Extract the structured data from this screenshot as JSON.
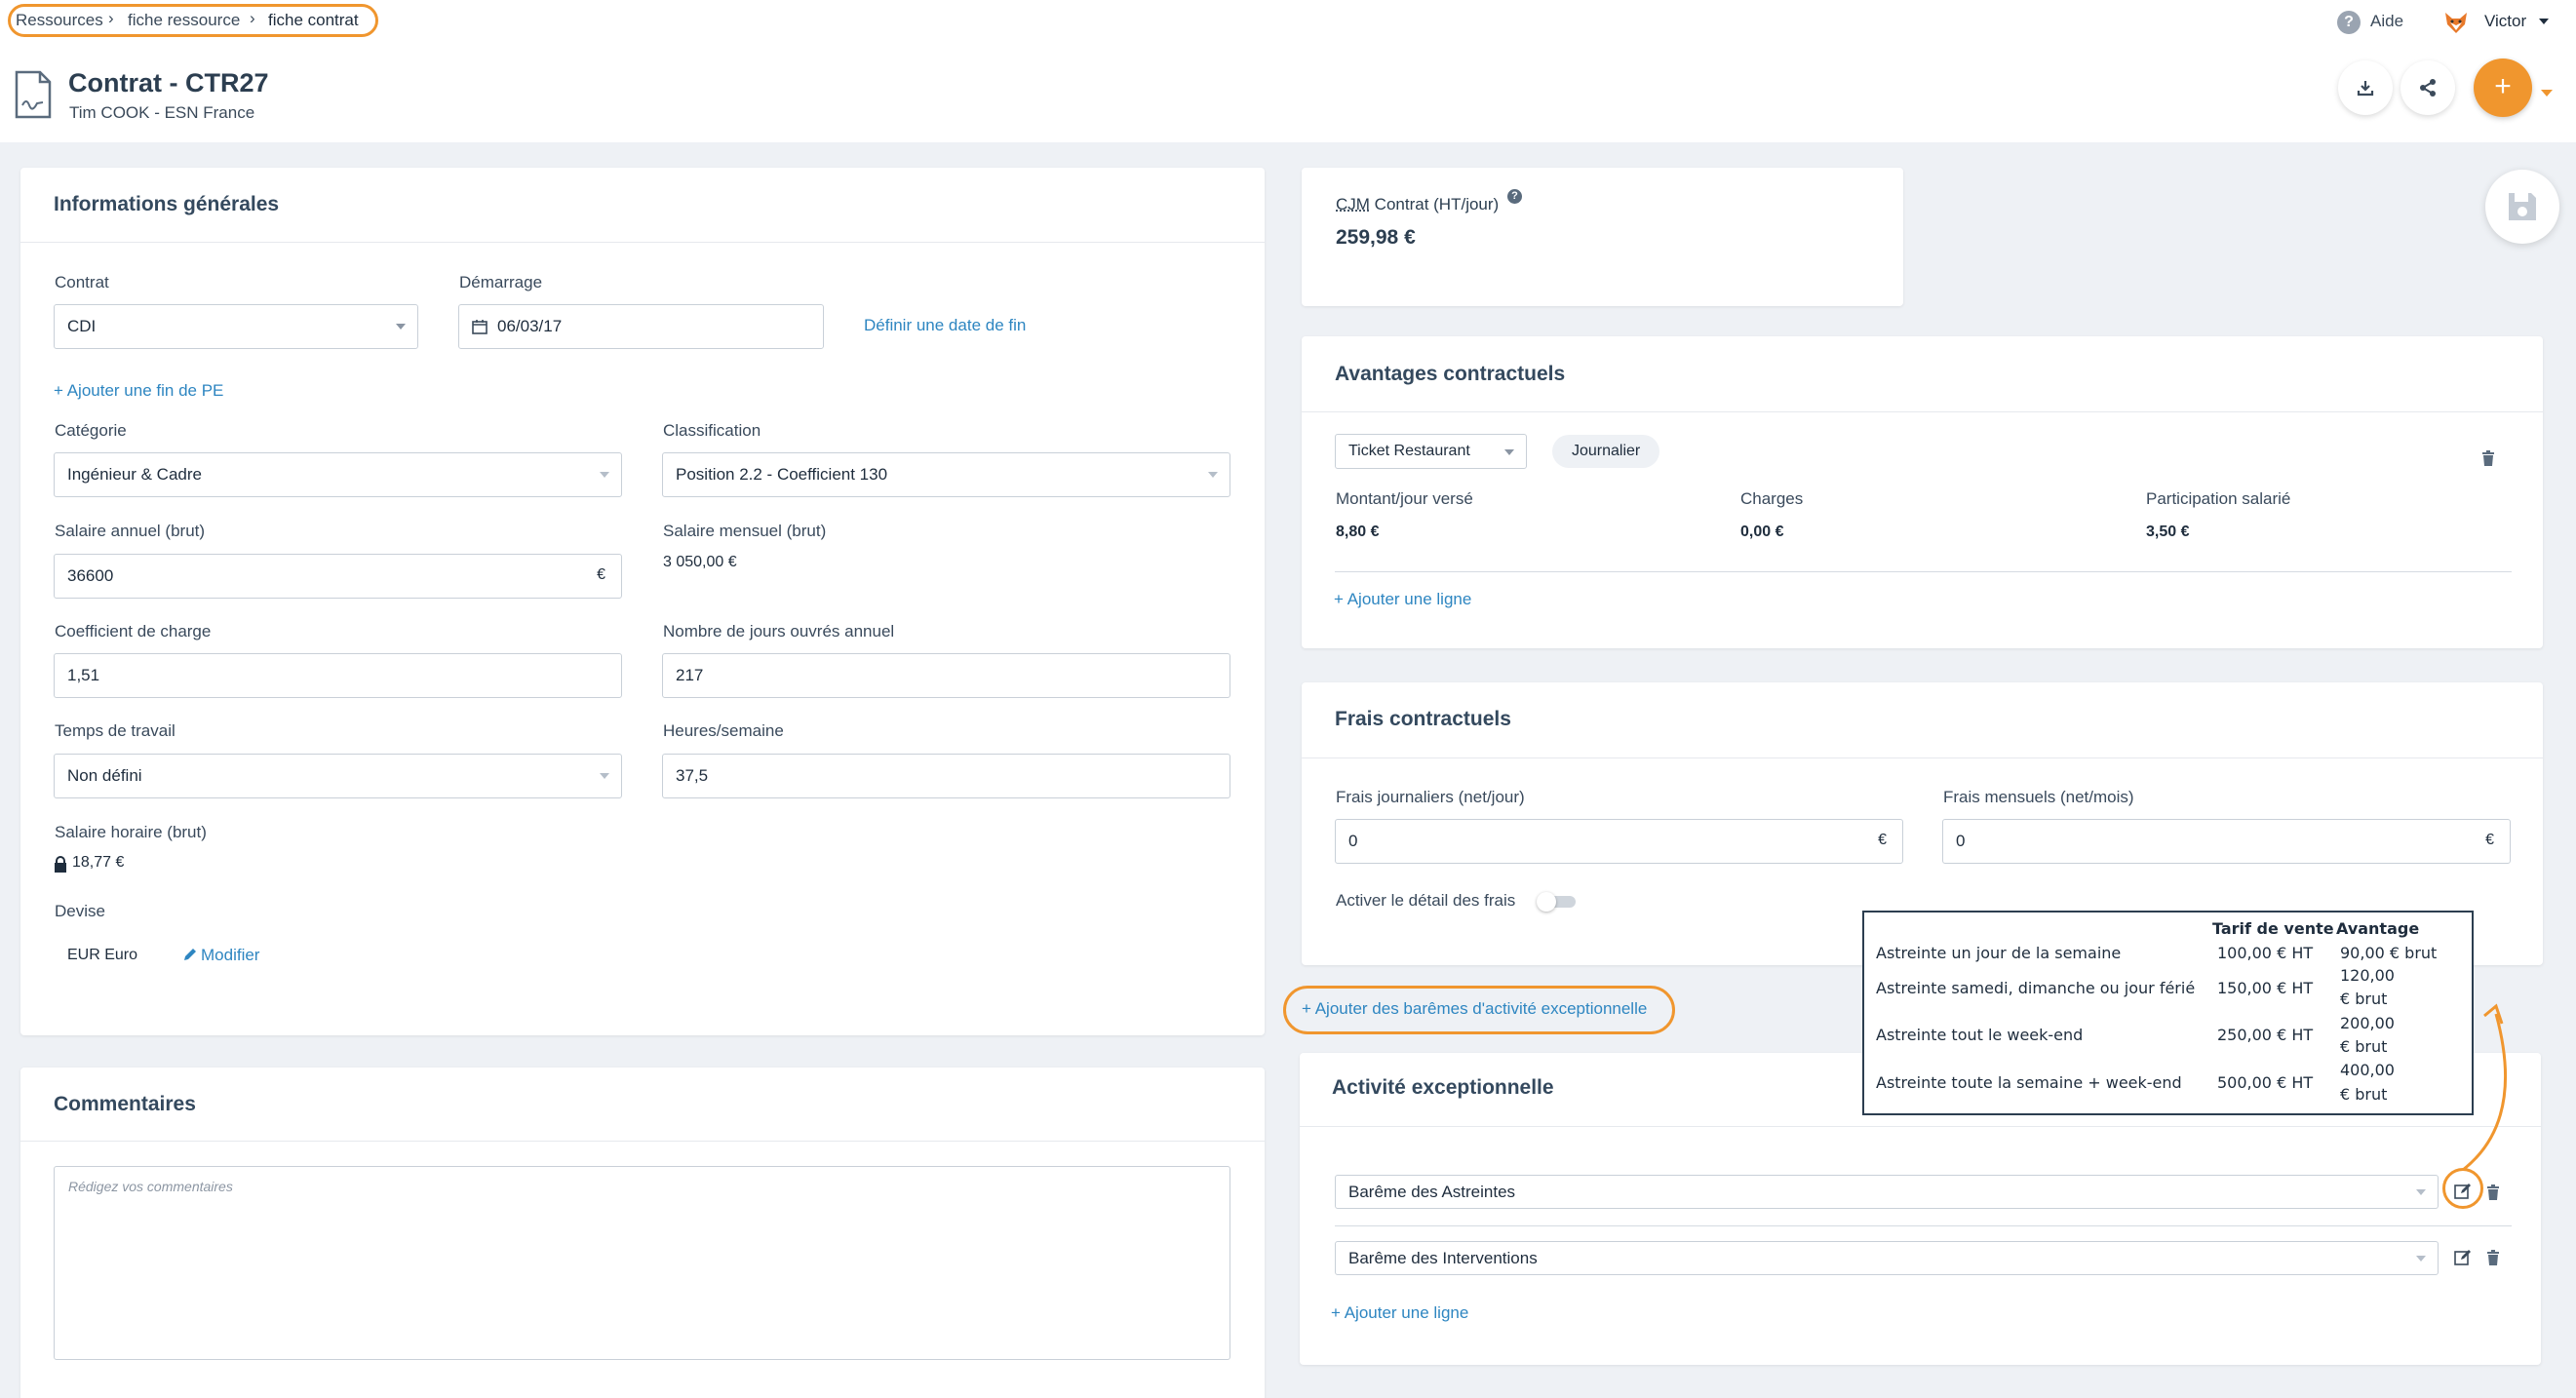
{
  "breadcrumb": {
    "items": [
      "Ressources",
      "fiche ressource",
      "fiche contrat"
    ]
  },
  "topbar": {
    "help_label": "Aide",
    "user_name": "Victor"
  },
  "header": {
    "title": "Contrat - CTR27",
    "subtitle": "Tim COOK - ESN France",
    "add_label": "+"
  },
  "general": {
    "title": "Informations générales",
    "contract_label": "Contrat",
    "contract_value": "CDI",
    "start_label": "Démarrage",
    "start_value": "06/03/17",
    "end_date_link": "Définir une date de fin",
    "add_pe_link": "+ Ajouter une fin de PE",
    "category_label": "Catégorie",
    "category_value": "Ingénieur & Cadre",
    "classification_label": "Classification",
    "classification_value": "Position 2.2 - Coefficient 130",
    "annual_salary_label": "Salaire annuel (brut)",
    "annual_salary_value": "36600",
    "currency_symbol": "€",
    "monthly_salary_label": "Salaire mensuel (brut)",
    "monthly_salary_value": "3 050,00 €",
    "charge_coef_label": "Coefficient de charge",
    "charge_coef_value": "1,51",
    "work_days_label": "Nombre de jours ouvrés annuel",
    "work_days_value": "217",
    "work_time_label": "Temps de travail",
    "work_time_value": "Non défini",
    "hours_label": "Heures/semaine",
    "hours_value": "37,5",
    "hourly_label": "Salaire horaire (brut)",
    "hourly_value": "18,77 €",
    "currency_label": "Devise",
    "currency_value": "EUR Euro",
    "modify_link": "Modifier"
  },
  "comments": {
    "title": "Commentaires",
    "placeholder": "Rédigez vos commentaires"
  },
  "cjm": {
    "label_abbr": "CJM",
    "label_rest": " Contrat (HT/jour)",
    "value": "259,98 €"
  },
  "benefits": {
    "title": "Avantages contractuels",
    "type_value": "Ticket Restaurant",
    "period_badge": "Journalier",
    "col1_label": "Montant/jour versé",
    "col1_value": "8,80 €",
    "col2_label": "Charges",
    "col2_value": "0,00 €",
    "col3_label": "Participation salarié",
    "col3_value": "3,50 €",
    "add_line": "+ Ajouter une ligne"
  },
  "fees": {
    "title": "Frais contractuels",
    "daily_label": "Frais journaliers (net/jour)",
    "daily_value": "0",
    "monthly_label": "Frais mensuels (net/mois)",
    "monthly_value": "0",
    "detail_toggle_label": "Activer le détail des frais"
  },
  "add_scales_link": "+ Ajouter des barêmes d'activité exceptionnelle",
  "exceptional": {
    "title": "Activité exceptionnelle",
    "row1_value": "Barême des Astreintes",
    "row2_value": "Barême des Interventions",
    "add_line": "+ Ajouter une ligne"
  },
  "tooltip": {
    "headers": [
      "Tarif de vente",
      "Avantage"
    ],
    "rows": [
      {
        "label": "Astreinte un jour de la semaine",
        "price": "100,00 € HT",
        "benefit_l1": "90,00 € brut",
        "benefit_l2": ""
      },
      {
        "label": "Astreinte samedi, dimanche ou jour férié",
        "price": "150,00 € HT",
        "benefit_l1": "120,00",
        "benefit_l2": "€ brut"
      },
      {
        "label": "Astreinte tout le week-end",
        "price": "250,00 € HT",
        "benefit_l1": "200,00",
        "benefit_l2": "€ brut"
      },
      {
        "label": "Astreinte toute la semaine + week-end",
        "price": "500,00 € HT",
        "benefit_l1": "400,00",
        "benefit_l2": "€ brut"
      }
    ]
  },
  "colors": {
    "accent": "#f0962e",
    "link": "#2e86c1",
    "background": "#eef1f5",
    "text": "#2c3e50"
  }
}
